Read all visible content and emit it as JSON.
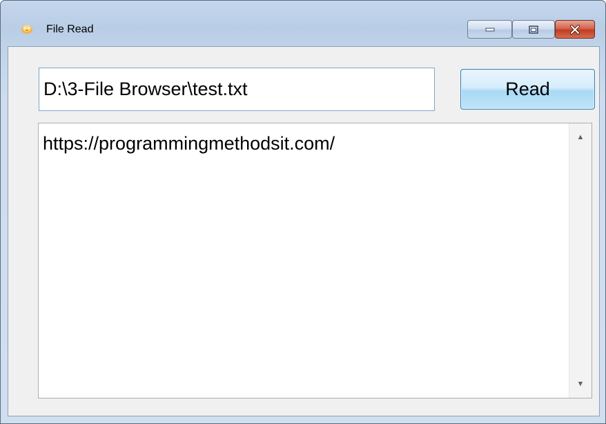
{
  "window": {
    "title": "File Read",
    "app_icon": "app-icon",
    "controls": {
      "minimize_icon": "minimize-icon",
      "maximize_icon": "maximize-icon",
      "close_icon": "close-icon"
    }
  },
  "form": {
    "path_value": "D:\\3-File Browser\\test.txt",
    "read_button_label": "Read",
    "content_text": "https://programmingmethodsit.com/"
  },
  "colors": {
    "title_frame": "#c3d6ec",
    "client_bg": "#f0f0f0",
    "close_red": "#c13d22",
    "button_blue": "#a9d9f5"
  }
}
